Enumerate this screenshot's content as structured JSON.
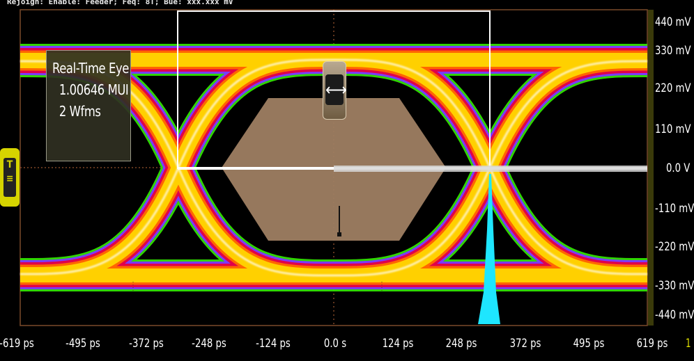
{
  "header": {
    "text": "Rejoign: Enable: Feeder; Feq: 8T; Bue: xxx.xxx mV"
  },
  "info_box": {
    "title": "Real-Time Eye",
    "ui_count": "1.00646 MUI",
    "wfms": "2 Wfms"
  },
  "trigger": {
    "label": "T"
  },
  "cursor": {
    "icon": "horizontal-double-arrow-icon",
    "glyph": "⟷"
  },
  "x_axis": {
    "ticks": [
      "-619 ps",
      "-495 ps",
      "-372 ps",
      "-248 ps",
      "-124 ps",
      "0.0 s",
      "124 ps",
      "248 ps",
      "372 ps",
      "495 ps",
      "619 ps"
    ]
  },
  "y_axis": {
    "ticks": [
      "440 mV",
      "330 mV",
      "220 mV",
      "110 mV",
      "0.0 V",
      "-110 mV",
      "-220 mV",
      "-330 mV",
      "-440 mV"
    ]
  },
  "zoom_indicator": "1",
  "colors": {
    "eye_core": "#ffffff",
    "eye_hot": "#ffd000",
    "eye_mid": "#ff6600",
    "eye_edge_red": "#e0004a",
    "eye_edge_blue": "#7a3cff",
    "eye_edge_green": "#32e000",
    "mask": "#9e7e62",
    "histogram": "#1ee6ff",
    "trigger": "#d6d400",
    "grid_orange": "#c06a3a"
  }
}
